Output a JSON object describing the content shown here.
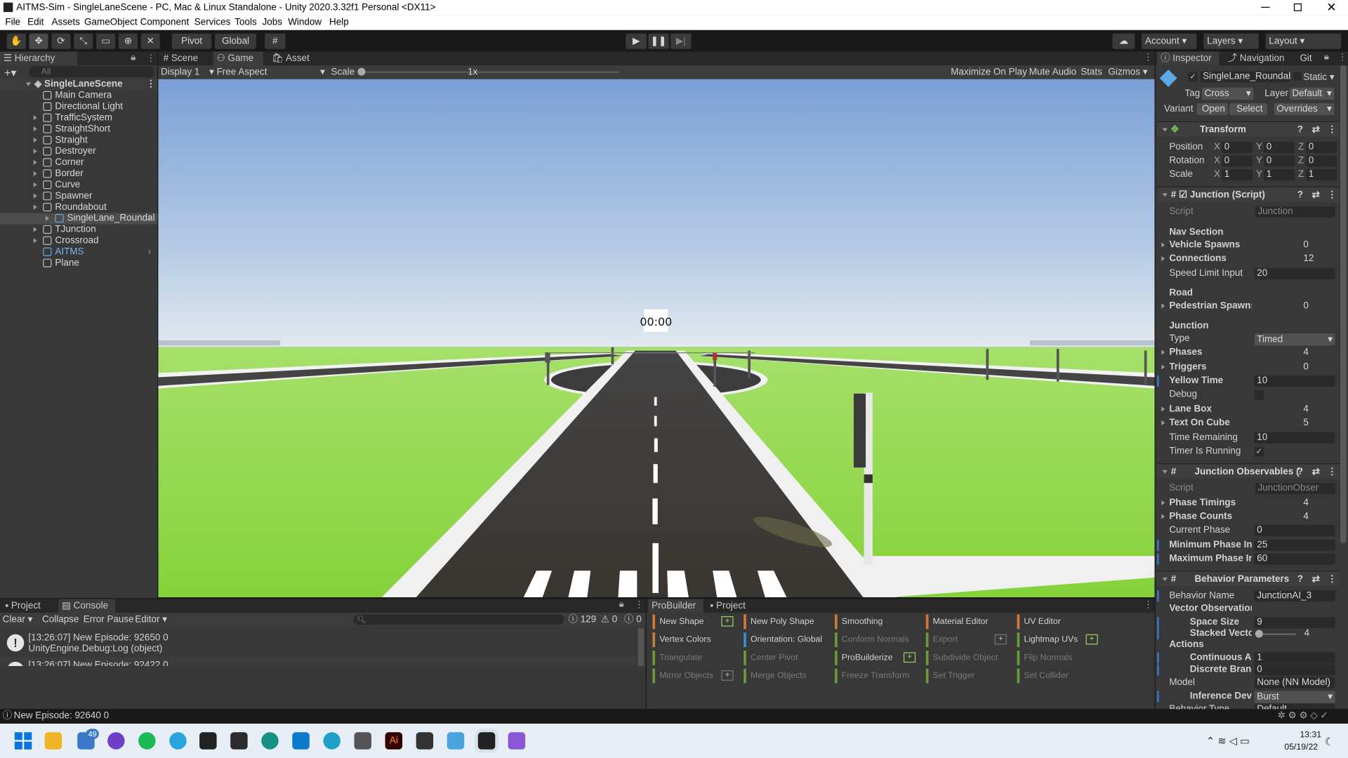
{
  "title": "AITMS-Sim - SingleLaneScene - PC, Mac & Linux Standalone - Unity 2020.3.32f1 Personal <DX11>",
  "menu": [
    "File",
    "Edit",
    "Assets",
    "GameObject",
    "Component",
    "Services",
    "Tools",
    "Jobs",
    "Window",
    "Help"
  ],
  "toolbar": {
    "pivot": "Pivot",
    "global": "Global",
    "account": "Account",
    "layers": "Layers",
    "layout": "Layout"
  },
  "hierarchy": {
    "tab": "Hierarchy",
    "search_placeholder": "All",
    "scene": "SingleLaneScene",
    "items": [
      {
        "label": "Main Camera",
        "indent": 1,
        "arrow": false
      },
      {
        "label": "Directional Light",
        "indent": 1,
        "arrow": false
      },
      {
        "label": "TrafficSystem",
        "indent": 1,
        "arrow": true
      },
      {
        "label": "StraightShort",
        "indent": 1,
        "arrow": true
      },
      {
        "label": "Straight",
        "indent": 1,
        "arrow": true
      },
      {
        "label": "Destroyer",
        "indent": 1,
        "arrow": true
      },
      {
        "label": "Corner",
        "indent": 1,
        "arrow": true
      },
      {
        "label": "Border",
        "indent": 1,
        "arrow": true
      },
      {
        "label": "Curve",
        "indent": 1,
        "arrow": true
      },
      {
        "label": "Spawner",
        "indent": 1,
        "arrow": true
      },
      {
        "label": "Roundabout",
        "indent": 1,
        "arrow": true
      },
      {
        "label": "SingleLane_Roundal",
        "indent": 2,
        "arrow": true
      },
      {
        "label": "TJunction",
        "indent": 1,
        "arrow": true
      },
      {
        "label": "Crossroad",
        "indent": 1,
        "arrow": true
      },
      {
        "label": "AITMS",
        "indent": 1,
        "arrow": false
      },
      {
        "label": "Plane",
        "indent": 1,
        "arrow": false
      }
    ]
  },
  "game": {
    "tabs": [
      "Scene",
      "Game",
      "Asset Store"
    ],
    "display": "Display 1",
    "aspect": "Free Aspect",
    "scale_label": "Scale",
    "scale_value": "1x",
    "options": [
      "Maximize On Play",
      "Mute Audio",
      "Stats",
      "Gizmos"
    ],
    "timer": "00:00"
  },
  "inspector": {
    "tabs": [
      "Inspector",
      "Navigation",
      "Git"
    ],
    "object_name": "SingleLane_Roundab",
    "static": "Static",
    "tag_label": "Tag",
    "tag": "Cross",
    "layer_label": "Layer",
    "layer": "Default",
    "variant": "Variant",
    "open": "Open",
    "select": "Select",
    "overrides": "Overrides",
    "transform": {
      "title": "Transform",
      "rows": [
        {
          "label": "Position",
          "x": "0",
          "y": "0",
          "z": "0"
        },
        {
          "label": "Rotation",
          "x": "0",
          "y": "0",
          "z": "0"
        },
        {
          "label": "Scale",
          "x": "1",
          "y": "1",
          "z": "1"
        }
      ]
    },
    "junction": {
      "title": "Junction (Script)",
      "script_label": "Script",
      "script": "Junction",
      "nav_section": "Nav Section",
      "vehicle_spawns": "Vehicle Spawns",
      "vehicle_spawns_v": "0",
      "connections": "Connections",
      "connections_v": "12",
      "speed_limit": "Speed Limit Input",
      "speed_limit_v": "20",
      "road": "Road",
      "pedestrian": "Pedestrian Spawns",
      "pedestrian_v": "0",
      "junction": "Junction",
      "type": "Type",
      "type_v": "Timed",
      "phases": "Phases",
      "phases_v": "4",
      "triggers": "Triggers",
      "triggers_v": "0",
      "yellow": "Yellow Time",
      "yellow_v": "10",
      "debug": "Debug",
      "lanebox": "Lane Box",
      "lanebox_v": "4",
      "textcube": "Text On Cube",
      "textcube_v": "5",
      "time_remaining": "Time Remaining",
      "time_remaining_v": "10",
      "timer_running": "Timer Is Running"
    },
    "observables": {
      "title": "Junction Observables (",
      "script_label": "Script",
      "script": "JunctionObser",
      "phase_timings": "Phase Timings",
      "phase_timings_v": "4",
      "phase_counts": "Phase Counts",
      "phase_counts_v": "4",
      "current_phase": "Current Phase",
      "current_phase_v": "0",
      "min_phase": "Minimum Phase Inte",
      "min_phase_v": "25",
      "max_phase": "Maximum Phase Inte",
      "max_phase_v": "60"
    },
    "behavior": {
      "title": "Behavior Parameters",
      "name_label": "Behavior Name",
      "name_v": "JunctionAI_3",
      "vector_obs": "Vector Observation",
      "space_size": "Space Size",
      "space_size_v": "9",
      "stacked": "Stacked Vector",
      "stacked_v": "4",
      "actions": "Actions",
      "continuous": "Continuous Act",
      "continuous_v": "1",
      "discrete": "Discrete Branc",
      "discrete_v": "0",
      "model": "Model",
      "model_v": "None (NN Model)",
      "inference": "Inference Devic",
      "inference_v": "Burst",
      "cut": "Behavior Type",
      "cut_v": "Default"
    }
  },
  "console": {
    "tabs": [
      "Project",
      "Console"
    ],
    "clear": "Clear",
    "collapse": "Collapse",
    "error_pause": "Error Pause",
    "editor": "Editor",
    "count_log": "129",
    "count_warn": "0",
    "count_err": "0",
    "entries": [
      {
        "line1": "[13:26:07] New Episode: 92650 0",
        "line2": "UnityEngine.Debug:Log (object)"
      },
      {
        "line1": "[13:26:07] New Episode: 92422 0",
        "line2": ""
      }
    ]
  },
  "probuilder": {
    "tabs": [
      "ProBuilder",
      "Project"
    ],
    "buttons": [
      {
        "label": "New Shape",
        "col": 0,
        "row": 0,
        "color": "#d07a3a",
        "dim": false,
        "plus": true
      },
      {
        "label": "New Poly Shape",
        "col": 1,
        "row": 0,
        "color": "#d07a3a",
        "dim": false,
        "plus": false
      },
      {
        "label": "Smoothing",
        "col": 2,
        "row": 0,
        "color": "#d07a3a",
        "dim": false,
        "plus": false
      },
      {
        "label": "Material Editor",
        "col": 3,
        "row": 0,
        "color": "#d07a3a",
        "dim": false,
        "plus": false
      },
      {
        "label": "UV Editor",
        "col": 4,
        "row": 0,
        "color": "#d07a3a",
        "dim": false,
        "plus": false
      },
      {
        "label": "Vertex Colors",
        "col": 0,
        "row": 1,
        "color": "#d07a3a",
        "dim": false,
        "plus": false
      },
      {
        "label": "Orientation: Global",
        "col": 1,
        "row": 1,
        "color": "#3a8fd0",
        "dim": false,
        "plus": false
      },
      {
        "label": "Conform Normals",
        "col": 2,
        "row": 1,
        "color": "#6b9a3a",
        "dim": true,
        "plus": false
      },
      {
        "label": "Export",
        "col": 3,
        "row": 1,
        "color": "#6b9a3a",
        "dim": true,
        "plus": true
      },
      {
        "label": "Lightmap UVs",
        "col": 4,
        "row": 1,
        "color": "#6b9a3a",
        "dim": false,
        "plus": true
      },
      {
        "label": "Triangulate",
        "col": 0,
        "row": 2,
        "color": "#6b9a3a",
        "dim": true,
        "plus": false
      },
      {
        "label": "Center Pivot",
        "col": 1,
        "row": 2,
        "color": "#6b9a3a",
        "dim": true,
        "plus": false
      },
      {
        "label": "ProBuilderize",
        "col": 2,
        "row": 2,
        "color": "#6b9a3a",
        "dim": false,
        "plus": true
      },
      {
        "label": "Subdivide Object",
        "col": 3,
        "row": 2,
        "color": "#6b9a3a",
        "dim": true,
        "plus": false
      },
      {
        "label": "Flip Normals",
        "col": 4,
        "row": 2,
        "color": "#6b9a3a",
        "dim": true,
        "plus": false
      },
      {
        "label": "Mirror Objects",
        "col": 0,
        "row": 3,
        "color": "#6b9a3a",
        "dim": true,
        "plus": true
      },
      {
        "label": "Merge Objects",
        "col": 1,
        "row": 3,
        "color": "#6b9a3a",
        "dim": true,
        "plus": false
      },
      {
        "label": "Freeze Transform",
        "col": 2,
        "row": 3,
        "color": "#6b9a3a",
        "dim": true,
        "plus": false
      },
      {
        "label": "Set Trigger",
        "col": 3,
        "row": 3,
        "color": "#6b9a3a",
        "dim": true,
        "plus": false
      },
      {
        "label": "Set Collider",
        "col": 4,
        "row": 3,
        "color": "#6b9a3a",
        "dim": true,
        "plus": false
      }
    ]
  },
  "status": "New Episode: 92640 0",
  "taskbar": {
    "time": "13:31",
    "date": "05/19/22",
    "badge": "49"
  },
  "colors": {
    "sky_top": "#7a9fd6",
    "sky_bottom": "#dbe6f0",
    "grass": "#8fd63f",
    "road": "#3d3d3d",
    "accent_blue": "#3a79c9"
  }
}
